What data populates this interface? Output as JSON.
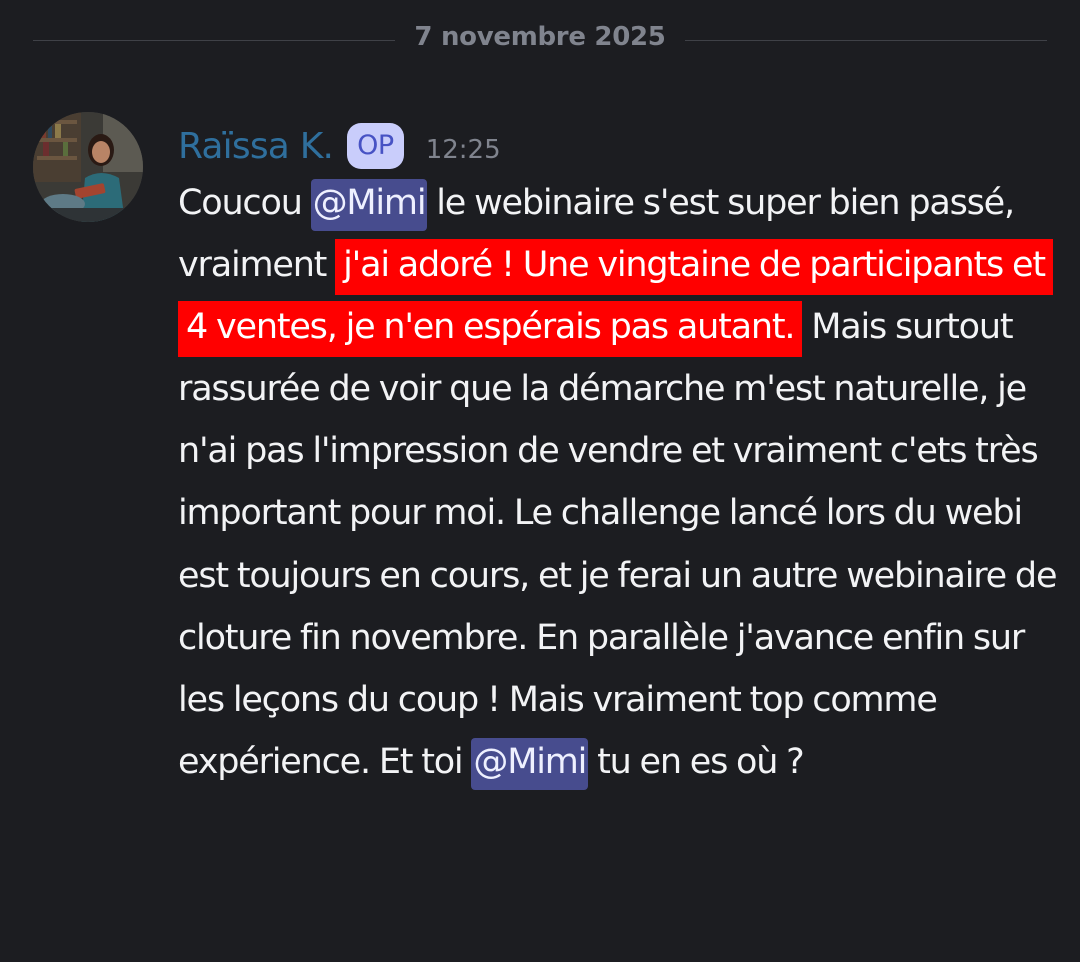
{
  "divider": {
    "date": "7 novembre 2025"
  },
  "message": {
    "author": "Raïssa K.",
    "badge": "OP",
    "time": "12:25",
    "text_1": "Coucou ",
    "mention_1": "@Mimi",
    "text_2": " le webinaire s'est super bien passé, vraiment ",
    "highlighted": "j'ai adoré ! Une vingtaine de participants et 4 ventes, je n'en espérais pas autant.",
    "text_3": " Mais surtout rassurée de voir que la démarche m'est naturelle, je n'ai pas l'impression de vendre et vraiment c'ets très important pour moi. Le challenge lancé lors du webi est toujours en cours, et je ferai un autre webinaire de cloture fin novembre. En parallèle j'avance enfin sur les leçons du coup ! Mais vraiment top comme expérience. Et toi ",
    "mention_2": "@Mimi",
    "text_4": " tu en es où ?"
  },
  "colors": {
    "background": "#1c1d21",
    "author": "#2f6f9d",
    "mention_bg": "#474c8e",
    "highlight_bg": "#ff0000",
    "badge_bg": "#c9cdfb"
  }
}
